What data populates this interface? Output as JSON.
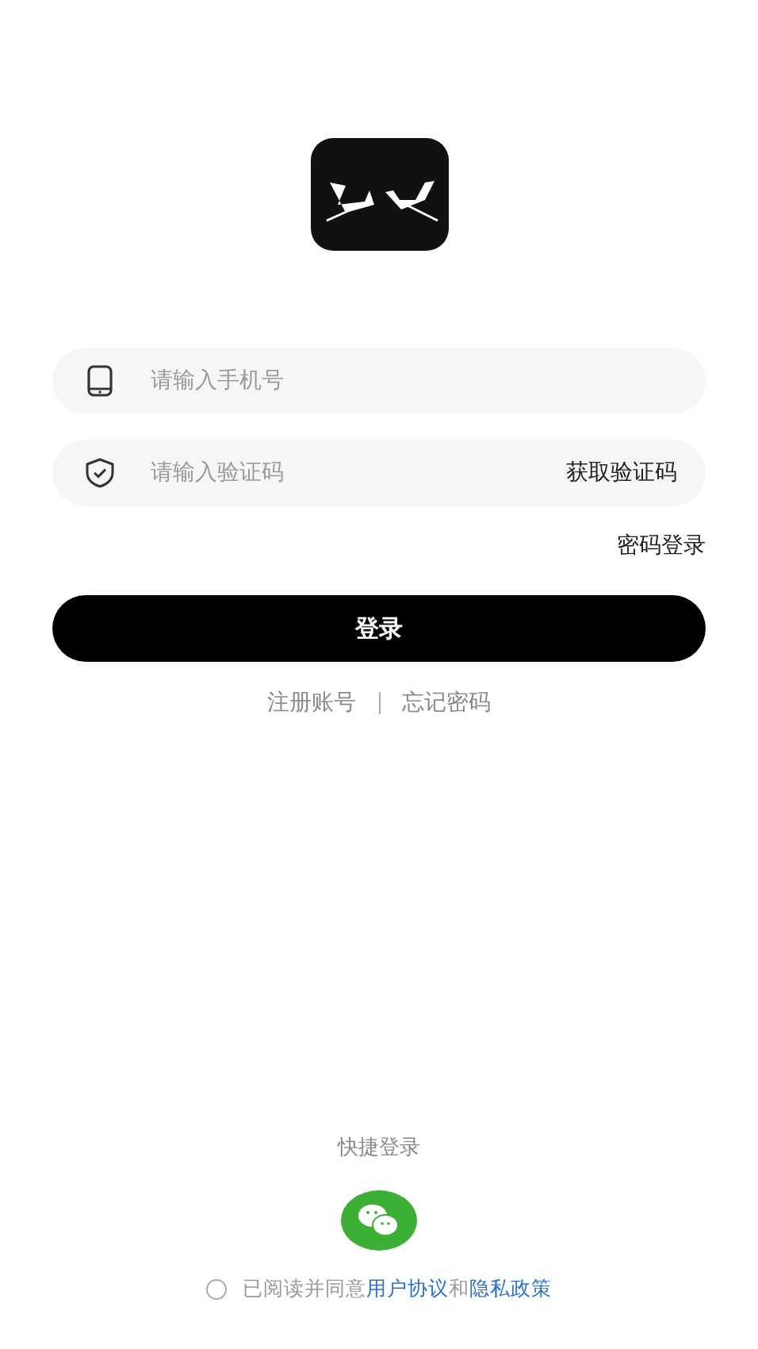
{
  "fields": [
    {
      "kind": "phone",
      "placeholder": "请输入手机号"
    },
    {
      "kind": "code",
      "placeholder": "请输入验证码",
      "action": "获取验证码"
    }
  ],
  "password_login": "密码登录",
  "login_button": "登录",
  "links": [
    "注册账号",
    "忘记密码"
  ],
  "quick_login": {
    "label": "快捷登录"
  },
  "agreement": {
    "checked": false,
    "text": "已阅读并同意",
    "links": [
      "用户协议",
      "隐私政策"
    ],
    "joiner": "和"
  }
}
